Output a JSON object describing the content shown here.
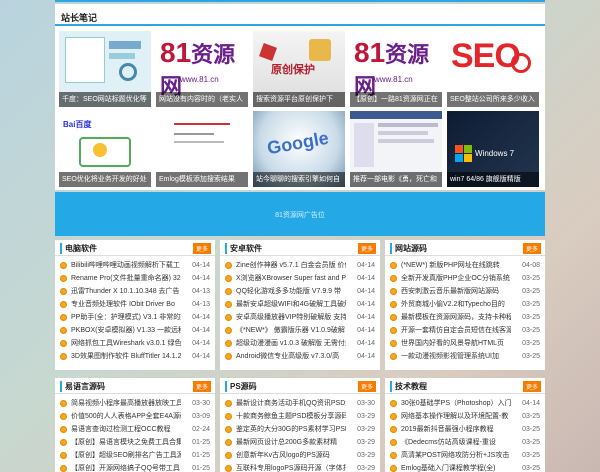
{
  "notes": {
    "title": "站长笔记",
    "items": [
      {
        "caption": "千度：SEO网站标题优化等",
        "art": "seo-doc"
      },
      {
        "caption": "网站没有内容时的（老实人",
        "art": "logo81",
        "logo_n": "81",
        "logo_z": "资源网",
        "logo_sub": "www.81.cn"
      },
      {
        "caption": "搜索资源平台原创保护下",
        "art": "yuanchuang",
        "stamp": "原创保护"
      },
      {
        "caption": "【原创】一路81资源网正在",
        "art": "logo81",
        "logo_n": "81",
        "logo_z": "资源网",
        "logo_sub": "www.81.cn"
      },
      {
        "caption": "SEO整站公司所来多少收入",
        "art": "seo",
        "seo_text": "SEO"
      },
      {
        "caption": "SEO优化将业务开发的好处",
        "art": "baidu",
        "brand": "Bai百度"
      },
      {
        "caption": "Emlog模板添加搜索结果",
        "art": "code"
      },
      {
        "caption": "站今聊聊的搜索引擎如何自",
        "art": "google",
        "brand": "Google"
      },
      {
        "caption": "推荐一部电影《勇，死亡和",
        "art": "site"
      },
      {
        "caption": "win7 64/86 旗舰版精版",
        "art": "win7",
        "brand": "Windows 7"
      }
    ]
  },
  "ad": {
    "text": "81资源网广告位"
  },
  "sections": [
    {
      "title": "电脑软件",
      "more": "更多",
      "rows": [
        {
          "t": "Bilibili哔哩哔哩动画视频解析下载工",
          "d": "04-14"
        },
        {
          "t": "Rename Pro(文件批量重命名器) 32位 6",
          "d": "04-14"
        },
        {
          "t": "迅雷Thunder X 10.1.10.348 去广告",
          "d": "04-13"
        },
        {
          "t": "专业音频处理软件 IObit Driver Bo",
          "d": "04-13"
        },
        {
          "t": "PP助手(全：护理模式) V3.1 非常的好用",
          "d": "04-14"
        },
        {
          "t": "PKBOX(安卓模拟器) V1.33 一款远程",
          "d": "04-14"
        },
        {
          "t": "网络抓包工具Wireshark v3.0.1 绿色",
          "d": "04-14"
        },
        {
          "t": "3D效果图制作软件 BluffTitler 14.1.2.",
          "d": "04-14"
        }
      ]
    },
    {
      "title": "安卓软件",
      "more": "更多",
      "rows": [
        {
          "t": "Zine创作神器 v5.7.1 白金会员版 价值",
          "d": "04-14"
        },
        {
          "t": "X浏览器XBrowser Super fast and P",
          "d": "04-14"
        },
        {
          "t": "QQ轻化游戏多多功能版 V7.9.9 带",
          "d": "04-14"
        },
        {
          "t": "最新安卓超级WIFI和4G破解工具破解",
          "d": "04-14"
        },
        {
          "t": "安卓高级播放器VIP特别破解版 支持",
          "d": "04-14"
        },
        {
          "t": "《*NEW*》 傲霸版乐器 V1.0.9破解",
          "d": "04-14"
        },
        {
          "t": "超级动漫漫画 v1.0.3 破解版 无需付费 免",
          "d": "04-14"
        },
        {
          "t": "Android微信专业高级版 v7.3.0/高",
          "d": "04-14"
        }
      ]
    },
    {
      "title": "网站源码",
      "more": "更多",
      "rows": [
        {
          "t": "(*NEW*) 新版PHP网址在线跳转",
          "d": "04-08"
        },
        {
          "t": "全新开发真版PHP企业OC分销系统",
          "d": "03-25"
        },
        {
          "t": "西安刺激云音乐最新版网站源码",
          "d": "03-25"
        },
        {
          "t": "外贸商城小偷V2.2和Typecho目的",
          "d": "03-25"
        },
        {
          "t": "最新模板在资源网源码，支持卡种程",
          "d": "03-25"
        },
        {
          "t": "开源一套精仿自定会员短信在线客源",
          "d": "03-25"
        },
        {
          "t": "世界国内好看的风景导航HTML页",
          "d": "03-25"
        },
        {
          "t": "一款动漫视频影视管理系统UI加",
          "d": "03-25"
        }
      ]
    },
    {
      "title": "易语言源码",
      "more": "更多",
      "rows": [
        {
          "t": "简易视频小程序最高播放器放映工具",
          "d": "03-30"
        },
        {
          "t": "价值500的人人表格APP全套E4A源码",
          "d": "03-09"
        },
        {
          "t": "易语言查询过检测工程OCC教程",
          "d": "02-24"
        },
        {
          "t": "【原创】易语言模块之免费工具合集",
          "d": "01-25"
        },
        {
          "t": "【原创】超级SEO刷排名广告工具源码",
          "d": "01-25"
        },
        {
          "t": "【原创】开源网络搞子QQ号带工具",
          "d": "01-25"
        }
      ]
    },
    {
      "title": "PS源码",
      "more": "更多",
      "rows": [
        {
          "t": "最新设计商务活动手机QQ资讯PSD源",
          "d": "03-30"
        },
        {
          "t": "十款商务鲸鱼主题PSD模板分享源码",
          "d": "03-29"
        },
        {
          "t": "鉴定英的大分30G的PS素材学习PSD",
          "d": "03-29"
        },
        {
          "t": "最新网页设计总200G多款素材精",
          "d": "03-29"
        },
        {
          "t": "创意新年Kv古风logo的PS源码",
          "d": "03-29"
        },
        {
          "t": "互联科专用logoPS源码开源（字体打",
          "d": "03-29"
        }
      ]
    },
    {
      "title": "技术教程",
      "more": "更多",
      "rows": [
        {
          "t": "30张0基础学PS（Photoshop）入门",
          "d": "04-14"
        },
        {
          "t": "网络基本操作理解以及环境配置-教",
          "d": "03-25"
        },
        {
          "t": "2019最新抖音最强小程序教程",
          "d": "03-25"
        },
        {
          "t": "《Dedecms仿站高级课程-重设",
          "d": "03-25"
        },
        {
          "t": "高清某POST网络攻防分析+JS攻击（高级",
          "d": "03-25"
        },
        {
          "t": "Emlog基础入门课程教学程(全)",
          "d": "03-25"
        }
      ]
    }
  ],
  "colors": {
    "accent": "#2ea7e0",
    "more": "#f57c00",
    "ad": "#25a9e6"
  }
}
